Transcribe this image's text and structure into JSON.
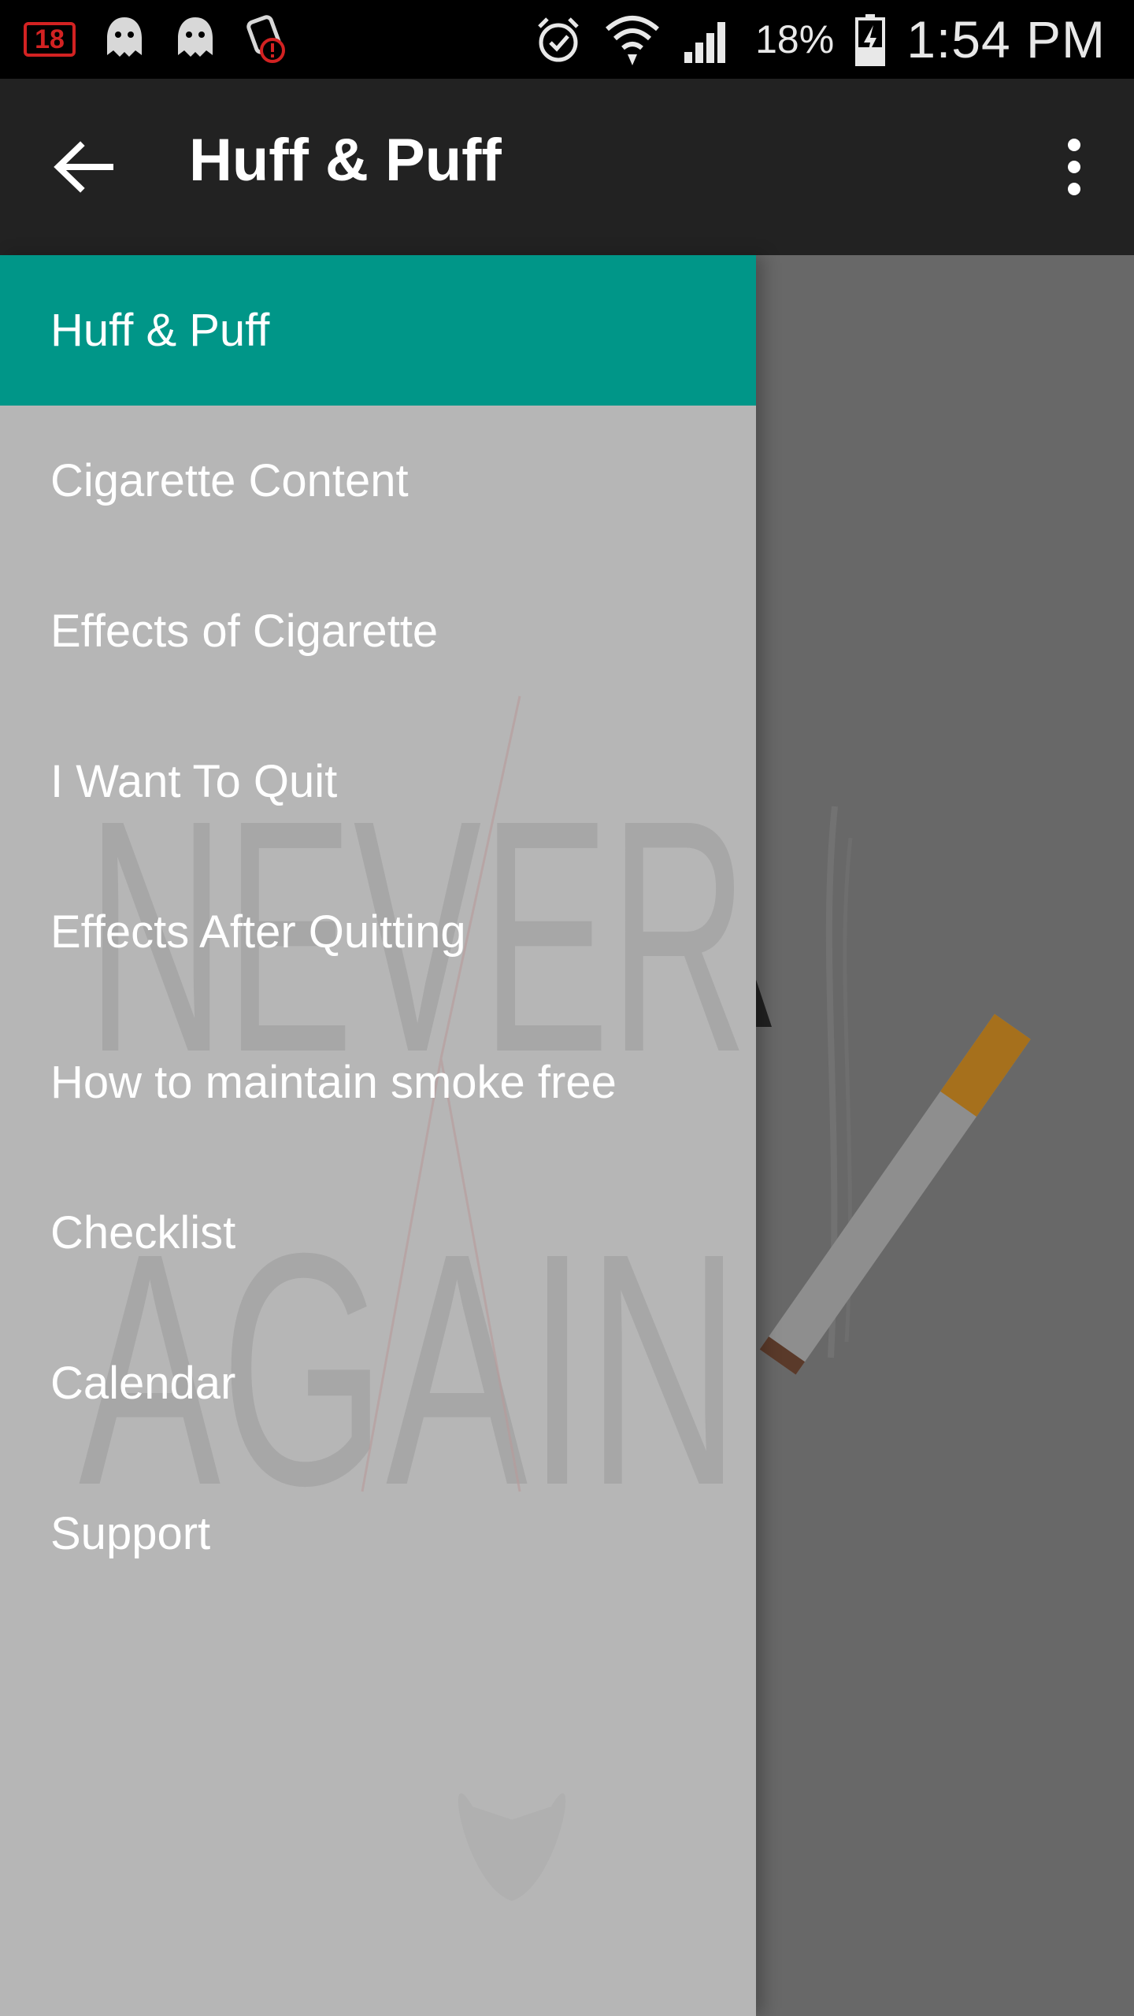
{
  "status_bar": {
    "notification_badge": "18",
    "battery_percent": "18%",
    "time": "1:54 PM",
    "icons": [
      "notification-badge-icon",
      "ghost-icon",
      "ghost-icon",
      "warning-app-icon",
      "alarm-icon",
      "wifi-icon",
      "signal-icon",
      "battery-charging-icon"
    ]
  },
  "app_bar": {
    "title": "Huff & Puff",
    "back_icon": "arrow-back-icon",
    "menu_icon": "more-vert-icon"
  },
  "drawer": {
    "items": [
      {
        "label": "Huff & Puff",
        "active": true
      },
      {
        "label": "Cigarette Content"
      },
      {
        "label": "Effects of Cigarette"
      },
      {
        "label": "I Want To Quit"
      },
      {
        "label": "Effects After Quitting"
      },
      {
        "label": "How to maintain smoke free"
      },
      {
        "label": "Checklist"
      },
      {
        "label": "Calendar"
      },
      {
        "label": "Support"
      }
    ],
    "watermark": [
      "NEVER",
      "AGAIN"
    ]
  },
  "colors": {
    "status_bar": "#000000",
    "app_bar": "#222222",
    "accent": "#009688",
    "drawer_bg": "#b6b6b6",
    "scrim_bg": "#686868"
  }
}
